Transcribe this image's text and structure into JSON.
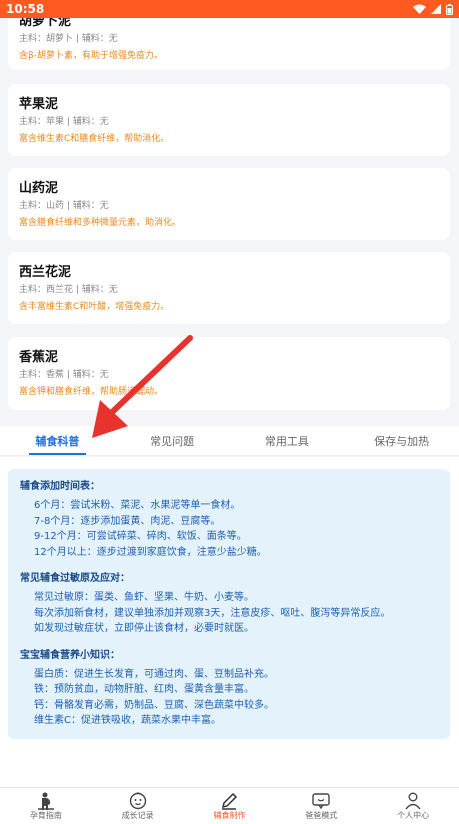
{
  "status_bar": {
    "time": "10:58"
  },
  "foods": [
    {
      "name": "胡萝卜泥",
      "ingredients": "主料：胡萝卜 | 辅料：无",
      "description": "含β-胡萝卜素，有助于增强免疫力。"
    },
    {
      "name": "苹果泥",
      "ingredients": "主料：苹果 | 辅料：无",
      "description": "富含维生素C和膳食纤维，帮助消化。"
    },
    {
      "name": "山药泥",
      "ingredients": "主料：山药 | 辅料：无",
      "description": "富含膳食纤维和多种微量元素，助消化。"
    },
    {
      "name": "西兰花泥",
      "ingredients": "主料：西兰花 | 辅料：无",
      "description": "含丰富维生素C和叶酸，增强免疫力。"
    },
    {
      "name": "香蕉泥",
      "ingredients": "主料：香蕉 | 辅料：无",
      "description": "富含钾和膳食纤维，帮助肠道蠕动。"
    }
  ],
  "tabs": [
    "辅食科普",
    "常见问题",
    "常用工具",
    "保存与加热"
  ],
  "knowledge": {
    "sections": [
      {
        "title": "辅食添加时间表：",
        "items": [
          "6个月：尝试米粉、菜泥、水果泥等单一食材。",
          "7-8个月：逐步添加蛋黄、肉泥、豆腐等。",
          "9-12个月：可尝试碎菜、碎肉、软饭、面条等。",
          "12个月以上：逐步过渡到家庭饮食，注意少盐少糖。"
        ]
      },
      {
        "title": "常见辅食过敏原及应对：",
        "items": [
          "常见过敏原：蛋类、鱼虾、坚果、牛奶、小麦等。",
          "每次添加新食材，建议单独添加并观察3天，注意皮疹、呕吐、腹泻等异常反应。",
          "如发现过敏症状，立即停止该食材，必要时就医。"
        ]
      },
      {
        "title": "宝宝辅食营养小知识：",
        "items": [
          "蛋白质：促进生长发育，可通过肉、蛋、豆制品补充。",
          "铁：预防贫血，动物肝脏、红肉、蛋黄含量丰富。",
          "钙：骨骼发育必需，奶制品、豆腐、深色蔬菜中较多。",
          "维生素C：促进铁吸收，蔬菜水果中丰富。"
        ]
      }
    ]
  },
  "bottom_nav": [
    {
      "label": "孕育指南",
      "icon": "pregnant-icon"
    },
    {
      "label": "成长记录",
      "icon": "baby-face-icon"
    },
    {
      "label": "辅食制作",
      "icon": "pen-icon"
    },
    {
      "label": "爸爸模式",
      "icon": "chat-bubble-icon"
    },
    {
      "label": "个人中心",
      "icon": "person-icon"
    }
  ],
  "colors": {
    "accent": "#ff5a1f",
    "tab_active": "#1f6fe0",
    "desc_orange": "#e88a1f",
    "info_bg": "#e3f2fb",
    "arrow": "#e8322d"
  }
}
